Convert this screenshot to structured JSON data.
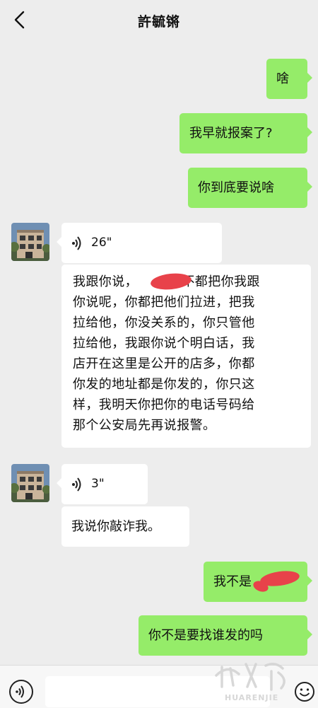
{
  "header": {
    "title": "許毓锵"
  },
  "messages": {
    "m1": "啥",
    "m2": "我早就报案了?",
    "m3": "你到底要说啥",
    "voice1": "26\"",
    "long_lines": [
      "我跟你说，",
      "你不都把你我跟",
      "你说呢，你都把他们拉进，把我",
      "拉给他，你没关系的，你只管他",
      "拉给他，我跟你说个明白话，我",
      "店开在这里是公开的店多，你都",
      "你发的地址都是你发的，你只这",
      "样，我明天你把你的电话号码给",
      "那个公安局先再说报警。"
    ],
    "voice2": "3\"",
    "m5": "我说你敲诈我。",
    "m6": "我不是",
    "m7": "你不是要找谁发的吗"
  },
  "watermark": {
    "text": "HUARENJIE"
  },
  "icons": {
    "back": "chevron-left-icon",
    "voice": "voice-icon",
    "emoji": "emoji-icon"
  },
  "colors": {
    "outgoing": "#95ec69",
    "incoming": "#ffffff",
    "background": "#ededed",
    "redaction": "#e8424a"
  }
}
